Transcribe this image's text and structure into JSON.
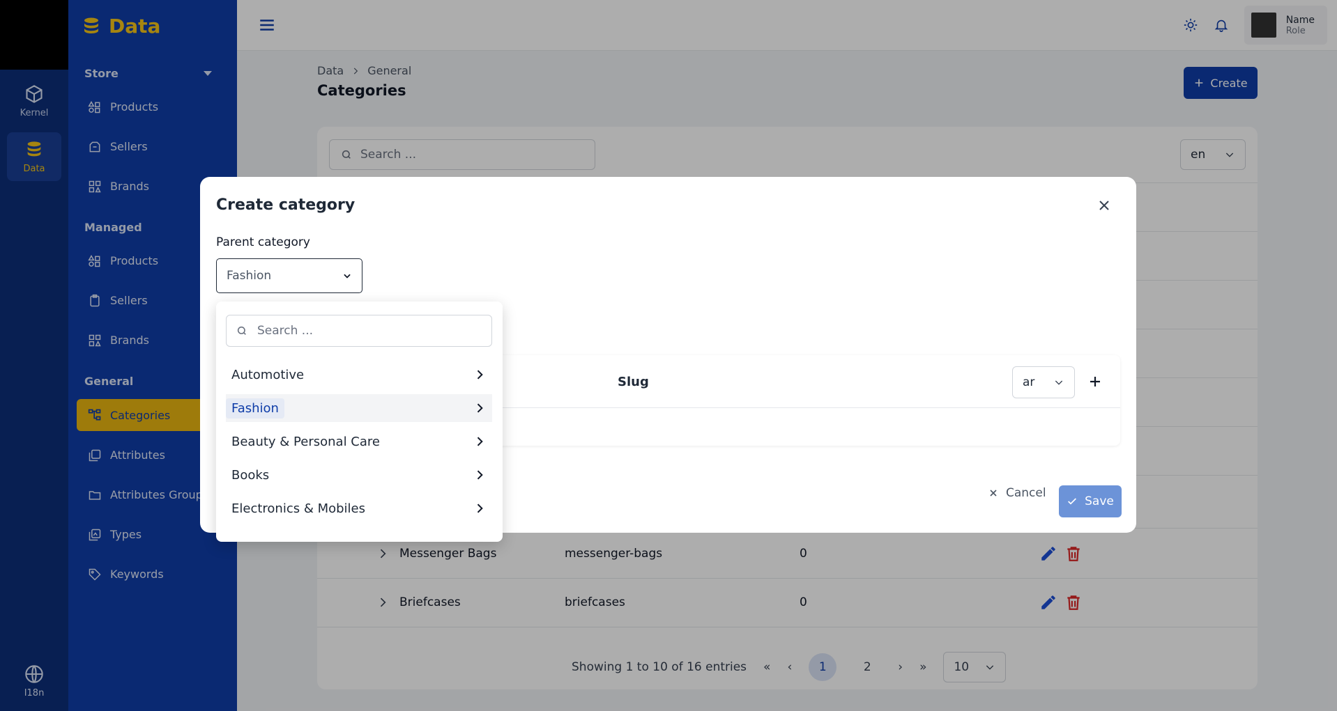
{
  "rail": {
    "items": [
      {
        "label": "Kernel",
        "icon": "cube-icon"
      },
      {
        "label": "Data",
        "icon": "database-icon"
      }
    ],
    "bottom": {
      "label": "I18n",
      "icon": "globe-icon"
    }
  },
  "sidebar": {
    "brand": "Data",
    "sections": [
      {
        "title": "Store",
        "items": [
          "Products",
          "Sellers",
          "Brands"
        ]
      },
      {
        "title": "Managed",
        "items": [
          "Products",
          "Sellers",
          "Brands"
        ]
      },
      {
        "title": "General",
        "items": [
          "Categories",
          "Attributes",
          "Attributes Groups",
          "Types",
          "Keywords"
        ]
      }
    ]
  },
  "topbar": {
    "user_name": "Name",
    "user_role": "Role"
  },
  "page": {
    "breadcrumb": [
      "Data",
      "General"
    ],
    "title": "Categories",
    "create_label": "Create",
    "search_placeholder": "Search ...",
    "lang": "en"
  },
  "table": {
    "rows": [
      {
        "name": "Messenger Bags",
        "slug": "messenger-bags",
        "count": "0"
      },
      {
        "name": "Briefcases",
        "slug": "briefcases",
        "count": "0"
      }
    ]
  },
  "pagination": {
    "info": "Showing 1 to 10 of 16 entries",
    "pages": [
      "1",
      "2"
    ],
    "current": "1",
    "per_page": "10"
  },
  "modal": {
    "title": "Create category",
    "parent_label": "Parent category",
    "parent_value": "Fashion",
    "slug_header": "Slug",
    "lang": "ar",
    "cancel_label": "Cancel",
    "save_label": "Save"
  },
  "dropdown": {
    "search_placeholder": "Search ...",
    "options": [
      "Automotive",
      "Fashion",
      "Beauty & Personal Care",
      "Books",
      "Electronics & Mobiles"
    ],
    "selected": "Fashion"
  },
  "colors": {
    "primary": "#0f3da8",
    "accent": "#e9b511",
    "rail": "#0d2f7a",
    "save": "#6c93d8",
    "danger": "#dc2626"
  }
}
